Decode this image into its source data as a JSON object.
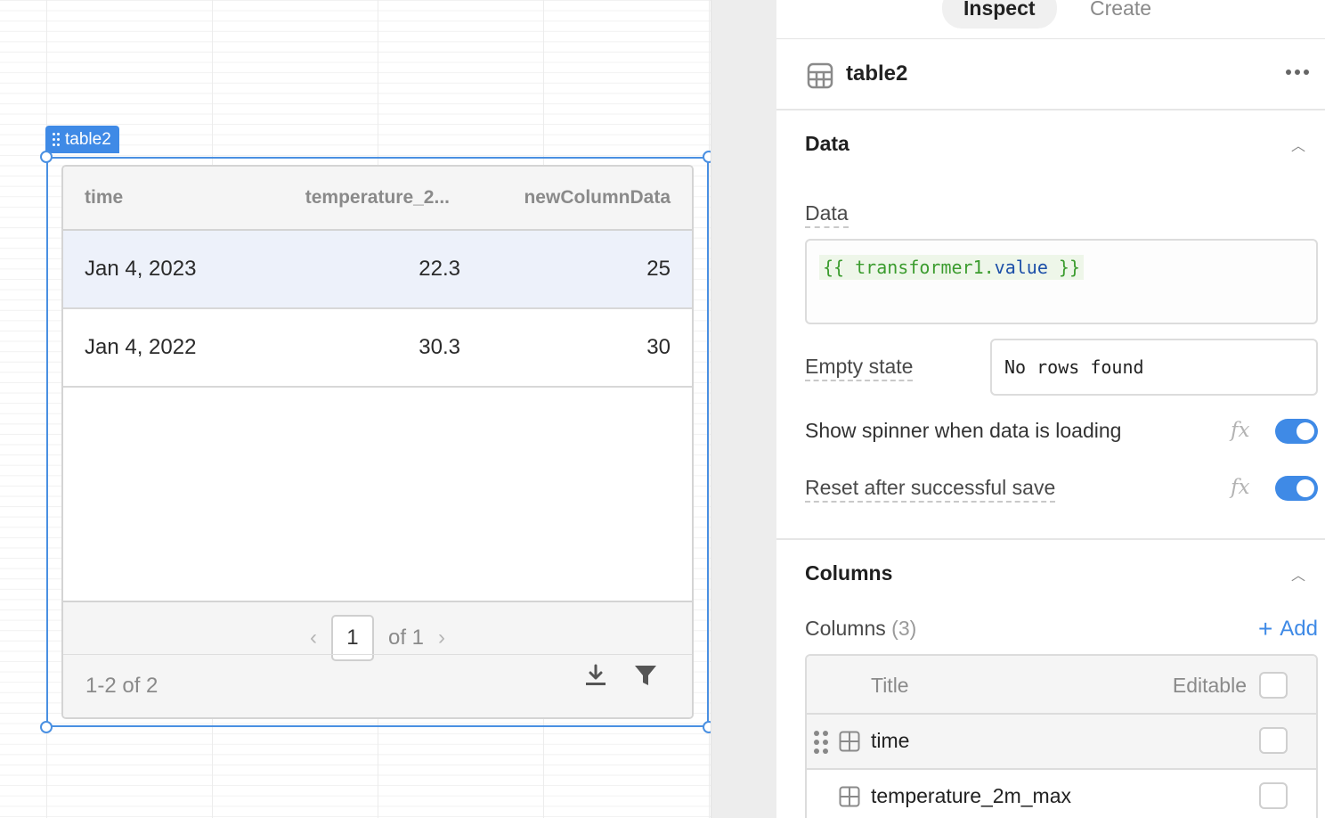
{
  "canvas": {
    "selection_tag": "table2",
    "table": {
      "columns": [
        "time",
        "temperature_2...",
        "newColumnData"
      ],
      "rows": [
        [
          "Jan 4, 2023",
          "22.3",
          "25"
        ],
        [
          "Jan 4, 2022",
          "30.3",
          "30"
        ]
      ],
      "pagination": {
        "page": "1",
        "of_label": "of 1"
      },
      "row_count": "1-2 of 2"
    }
  },
  "inspector": {
    "tabs": [
      {
        "label": "Inspect",
        "active": true
      },
      {
        "label": "Create",
        "active": false
      }
    ],
    "component_name": "table2",
    "data_section": {
      "title": "Data",
      "data_label": "Data",
      "data_code_open": "{{ transformer1.",
      "data_code_prop": "value",
      "data_code_close": " }}",
      "empty_state_label": "Empty state",
      "empty_state_value": "No rows found",
      "spinner_label": "Show spinner when data is loading",
      "spinner_on": true,
      "reset_label": "Reset after successful save",
      "reset_on": true,
      "fx_label": "fx"
    },
    "columns_section": {
      "title": "Columns",
      "columns_label": "Columns",
      "columns_count": "(3)",
      "add_label": "Add",
      "header_title": "Title",
      "header_editable": "Editable",
      "items": [
        {
          "name": "time"
        },
        {
          "name": "temperature_2m_max"
        }
      ]
    }
  },
  "colors": {
    "accent": "#3f8ae6",
    "selected_row": "#edf1fa"
  },
  "icons": [
    "table-icon",
    "more-icon",
    "chevron-up-icon",
    "chevron-left-icon",
    "chevron-right-icon",
    "download-icon",
    "filter-icon",
    "drag-handle-icon",
    "plus-icon"
  ]
}
